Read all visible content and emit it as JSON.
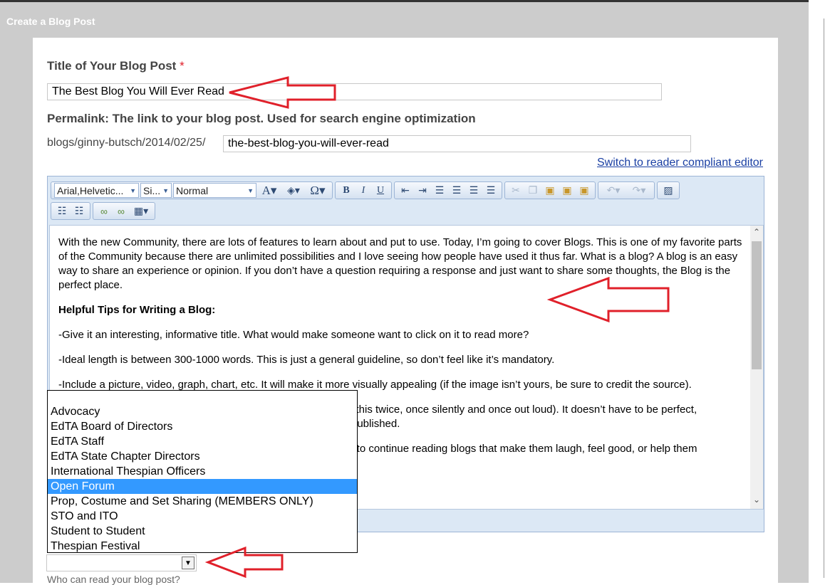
{
  "page": {
    "title": "Create a Blog Post"
  },
  "form": {
    "title_label": "Title of Your Blog Post",
    "required_mark": "*",
    "title_value": "The Best Blog You Will Ever Read",
    "permalink_label": "Permalink: The link to your blog post. Used for search engine optimization",
    "permalink_prefix": "blogs/ginny-butsch/2014/02/25/",
    "permalink_value": "the-best-blog-you-will-ever-read",
    "switch_editor_link": "Switch to reader compliant editor"
  },
  "toolbar": {
    "font_name": "Arial,Helvetic...",
    "font_size": "Si...",
    "format_block": "Normal",
    "icons": [
      "font-color-icon",
      "highlight-icon",
      "special-char-icon",
      "bold-icon",
      "italic-icon",
      "underline-icon",
      "outdent-icon",
      "indent-icon",
      "align-left-icon",
      "align-center-icon",
      "align-right-icon",
      "justify-icon",
      "cut-icon",
      "copy-icon",
      "paste-icon",
      "paste-text-icon",
      "paste-word-icon",
      "undo-icon",
      "redo-icon",
      "image-icon",
      "numbered-list-icon",
      "bulleted-list-icon",
      "link-icon",
      "unlink-icon",
      "table-icon"
    ]
  },
  "editor": {
    "paragraphs": [
      "With the new Community, there are lots of features to learn about and put to use. Today, I’m going to cover Blogs. This is one of my favorite parts of the Community because there are unlimited possibilities and I love seeing how people have used it thus far. What is a blog? A blog is an easy way to share an experience or opinion. If you don’t have a question requiring a response and just want to share some thoughts, the Blog is the perfect place.",
      "Helpful Tips for Writing a Blog:",
      "-Give it an interesting, informative title. What would make someone want to click on it to read more?",
      "-Ideal length is between 300-1000 words. This is just a general guideline, so don’t feel like it’s mandatory.",
      "-Include a picture, video, graph, chart, etc. It will make it more visually appealing (if the image isn’t yours, be sure to credit the source).",
      "o this twice, once silently and once out loud). It doesn’t have to be perfect,",
      "published.",
      "y to continue reading blogs that make them laugh, feel good, or help them"
    ]
  },
  "dropdown": {
    "options": [
      "Advocacy",
      "EdTA Board of Directors",
      "EdTA Staff",
      "EdTA State Chapter Directors",
      "International Thespian Officers",
      "Open Forum",
      "Prop, Costume and Set Sharing (MEMBERS ONLY)",
      "STO and ITO",
      "Student to Student",
      "Thespian Festival"
    ],
    "selected": "Open Forum"
  },
  "select": {
    "value": ""
  },
  "help": {
    "who_can_read": "Who can read your blog post?"
  },
  "colors": {
    "panel": "#cccccc",
    "accent": "#3399ff",
    "arrow": "#e0202a",
    "link": "#1a3fa3"
  }
}
